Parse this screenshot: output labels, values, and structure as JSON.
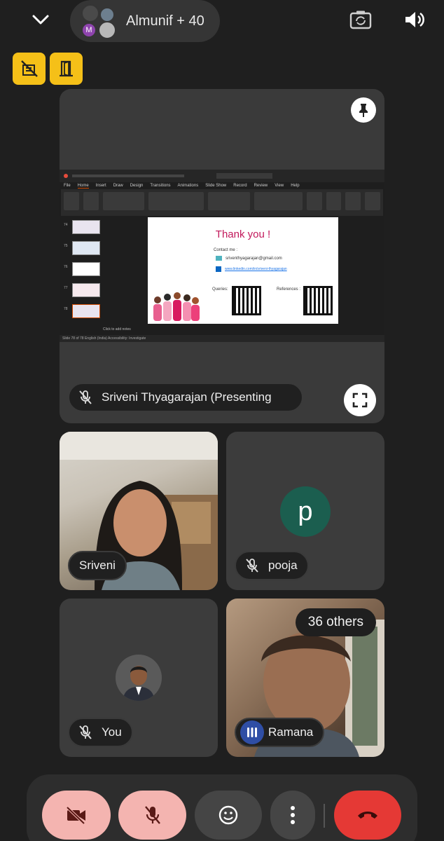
{
  "header": {
    "meeting_title": "Almunif + 40",
    "avatar_initial": "M"
  },
  "presentation": {
    "presenter_label": "Sriveni Thyagarajan (Presenting",
    "slide": {
      "title": "Thank you !",
      "contact_label": "Contact me :",
      "email": "sriventhyagarajan@gmail.com",
      "linkedin": "www.linkedin.com/in/sriveni-thyagarajan",
      "queries_label": "Queries:",
      "references_label": "References :"
    },
    "ppt_menu": [
      "File",
      "Home",
      "Insert",
      "Draw",
      "Design",
      "Transitions",
      "Animations",
      "Slide Show",
      "Record",
      "Review",
      "View",
      "Help"
    ],
    "thumb_numbers": [
      "74",
      "75",
      "76",
      "77",
      "78"
    ],
    "notes_placeholder": "Click to add notes",
    "status_text": "Slide 78 of 78    English (India)    Accessibility: Investigate"
  },
  "participants": {
    "sriveni": "Sriveni",
    "pooja": "pooja",
    "pooja_initial": "p",
    "you": "You",
    "ramana": "Ramana",
    "others": "36 others"
  },
  "colors": {
    "background": "#1f1f1f",
    "tile": "#3c3c3c",
    "yellow_buttons": "#f5c018",
    "muted_button": "#f4b4b0",
    "end_call": "#e53935",
    "pooja_avatar": "#1b5e4f"
  }
}
